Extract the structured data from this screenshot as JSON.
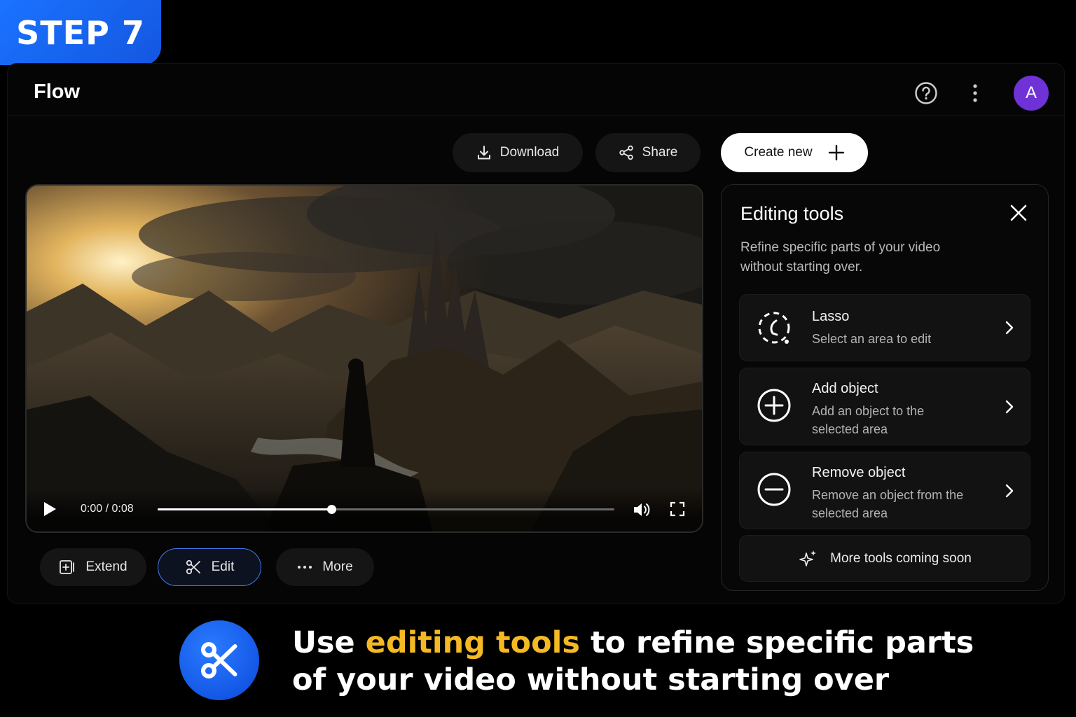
{
  "badge": {
    "text": "STEP 7",
    "color": "#1a73ff"
  },
  "header": {
    "title": "Flow",
    "avatar_letter": "A",
    "avatar_color": "#6e32d6"
  },
  "toolbar": {
    "download_label": "Download",
    "share_label": "Share",
    "create_label": "Create new"
  },
  "player": {
    "time": "0:00 / 0:08",
    "progress": 0.38
  },
  "actions": {
    "extend_label": "Extend",
    "edit_label": "Edit",
    "more_label": "More"
  },
  "panel": {
    "title": "Editing tools",
    "description": "Refine specific parts of your video without starting over.",
    "tools": [
      {
        "name": "Lasso",
        "desc": "Select an area to edit",
        "icon": "lasso-icon"
      },
      {
        "name": "Add object",
        "desc": "Add an object to the selected area",
        "icon": "plus-circle-icon"
      },
      {
        "name": "Remove object",
        "desc": "Remove an object from the selected area",
        "icon": "minus-circle-icon"
      }
    ],
    "coming_soon": "More tools coming soon"
  },
  "caption": {
    "pre": "Use ",
    "highlight": "editing tools",
    "post": " to refine specific parts of your video without starting over",
    "highlight_color": "#f4b923"
  }
}
